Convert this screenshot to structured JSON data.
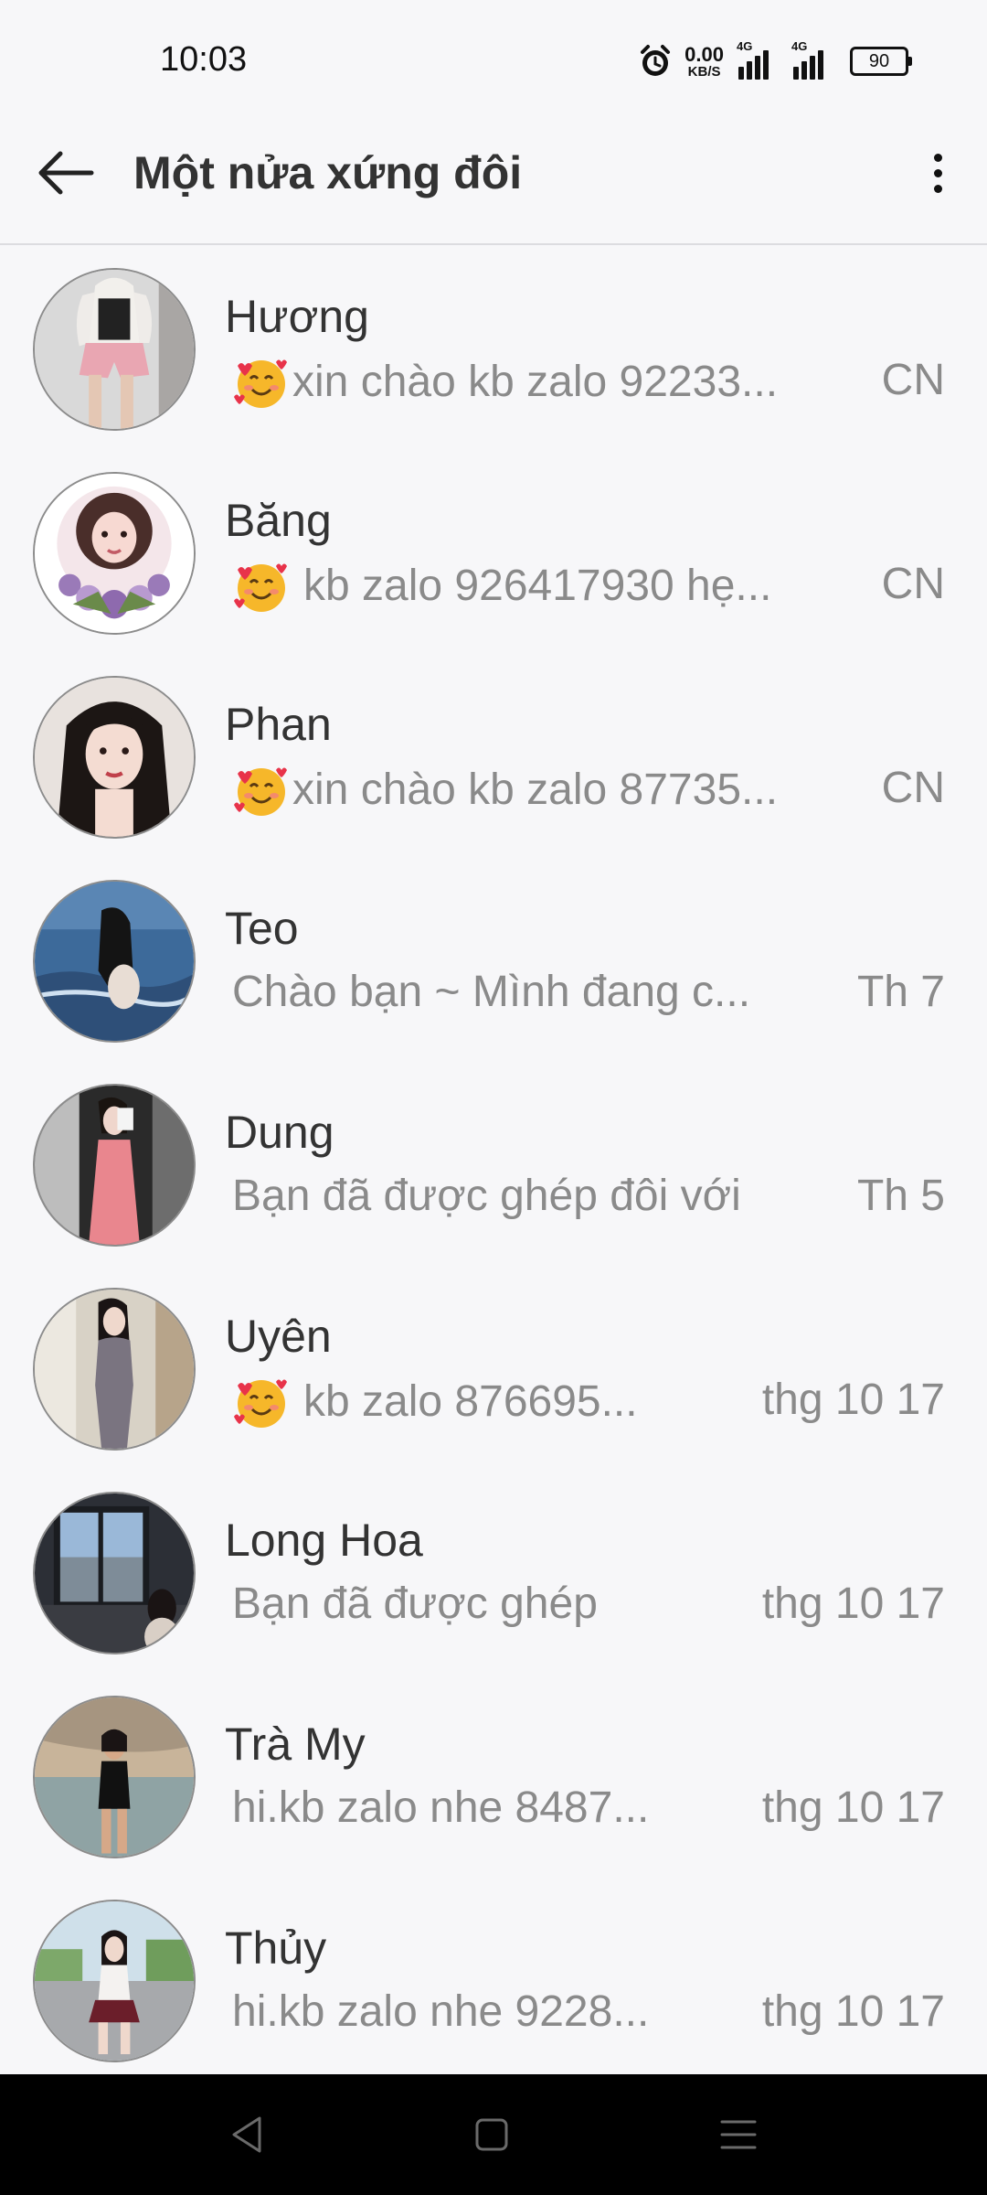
{
  "status_bar": {
    "time": "10:03",
    "net_speed_value": "0.00",
    "net_speed_unit": "KB/S",
    "signal1_tag": "4G",
    "signal2_tag": "4G",
    "battery": "90"
  },
  "app_bar": {
    "title": "Một nửa xứng đôi"
  },
  "chats": [
    {
      "name": "Hương",
      "preview": "xin chào kb zalo 92233...",
      "emoji": true,
      "emoji_spaced": false,
      "time": "CN"
    },
    {
      "name": "Băng",
      "preview": "kb zalo 926417930 hẹ...",
      "emoji": true,
      "emoji_spaced": true,
      "time": "CN"
    },
    {
      "name": "Phan",
      "preview": "xin chào kb zalo 87735...",
      "emoji": true,
      "emoji_spaced": false,
      "time": "CN"
    },
    {
      "name": "Teo",
      "preview": "Chào bạn ~ Mình đang c...",
      "emoji": false,
      "time": "Th 7"
    },
    {
      "name": "Dung",
      "preview": "Bạn đã được ghép đôi với",
      "emoji": false,
      "time": "Th 5"
    },
    {
      "name": "Uyên",
      "preview": "kb zalo 876695...",
      "emoji": true,
      "emoji_spaced": true,
      "time": "thg 10 17"
    },
    {
      "name": "Long Hoa",
      "preview": "Bạn đã được ghép",
      "emoji": false,
      "time": "thg 10 17"
    },
    {
      "name": "Trà My",
      "preview": "hi.kb zalo nhe 8487...",
      "emoji": false,
      "time": "thg 10 17"
    },
    {
      "name": "Thủy",
      "preview": "hi.kb zalo nhe 9228...",
      "emoji": false,
      "time": "thg 10 17"
    }
  ],
  "colors": {
    "background": "#f7f7f9",
    "text_primary": "#333333",
    "text_secondary": "#8a8a8a",
    "nav_bar": "#000000"
  }
}
